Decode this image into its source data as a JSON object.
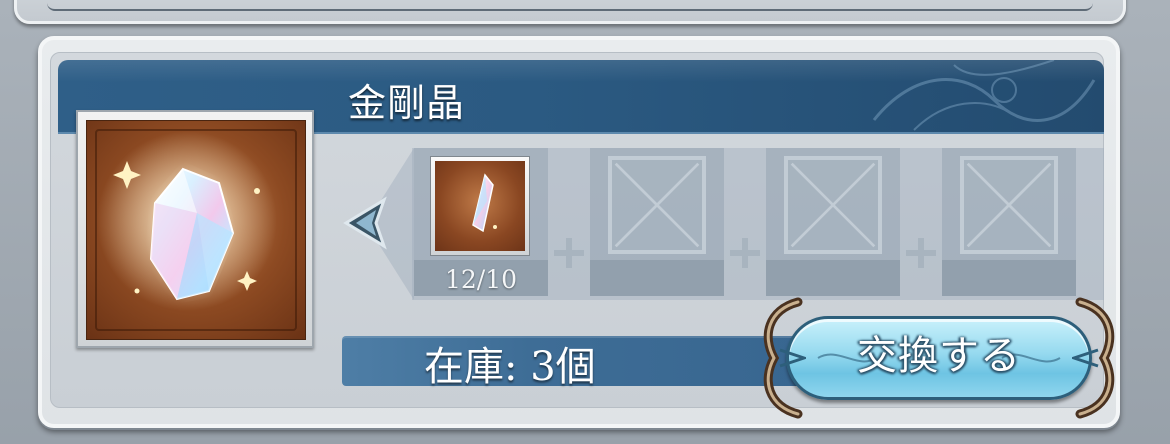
{
  "item": {
    "name": "金剛晶",
    "icon": "crystal-icon"
  },
  "materials": {
    "slots": [
      {
        "icon": "crystal-shard-icon",
        "count": "12/10",
        "filled": true
      },
      {
        "icon": "empty-slot-icon",
        "count": "",
        "filled": false
      },
      {
        "icon": "empty-slot-icon",
        "count": "",
        "filled": false
      },
      {
        "icon": "empty-slot-icon",
        "count": "",
        "filled": false
      }
    ]
  },
  "stock": {
    "text": "在庫: 3個"
  },
  "actions": {
    "exchange_label": "交換する"
  },
  "colors": {
    "banner": "#2f5f88",
    "button": "#95d9ef",
    "panel": "#d3d8dd"
  }
}
